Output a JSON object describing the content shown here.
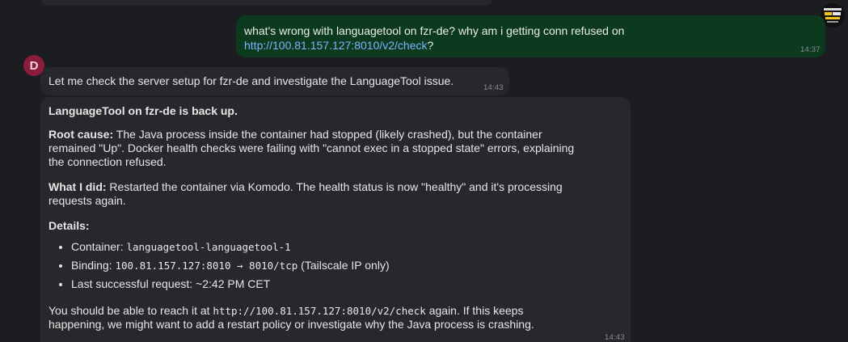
{
  "user_message": {
    "text_before_link": "what's wrong with languagetool on fzr-de? why am i getting conn refused on ",
    "link": "http://100.81.157.127:8010/v2/check",
    "text_after_link": "?",
    "time": "14:37",
    "avatar_icon": "user-avatar-icon"
  },
  "bot": {
    "avatar_letter": "D",
    "avatar_color": "#8b1c3b"
  },
  "bot_message_1": {
    "text": "Let me check the server setup for fzr-de and investigate the LanguageTool issue.",
    "time": "14:43"
  },
  "bot_message_2": {
    "heading": "LanguageTool on fzr-de is back up.",
    "root_cause_label": "Root cause:",
    "root_cause_text": " The Java process inside the container had stopped (likely crashed), but the container remained \"Up\". Docker health checks were failing with \"cannot exec in a stopped state\" errors, explaining the connection refused.",
    "what_i_did_label": "What I did:",
    "what_i_did_text": " Restarted the container via Komodo. The health status is now \"healthy\" and it's processing requests again.",
    "details_label": "Details:",
    "details": [
      {
        "label": "Container: ",
        "code": "languagetool-languagetool-1",
        "suffix": ""
      },
      {
        "label": "Binding: ",
        "code": "100.81.157.127:8010 → 8010/tcp",
        "suffix": " (Tailscale IP only)"
      },
      {
        "label": "Last successful request: ~2:42 PM CET",
        "code": "",
        "suffix": ""
      }
    ],
    "closing_before_code": "You should be able to reach it at ",
    "closing_code": "http://100.81.157.127:8010/v2/check",
    "closing_after_code": " again. If this keeps happening, we might want to add a restart policy or investigate why the Java process is crashing.",
    "time": "14:43"
  },
  "colors": {
    "background": "#1c1d21",
    "user_bubble": "#0c3a1f",
    "bot_bubble": "#27282c",
    "link": "#7cb3ff"
  }
}
